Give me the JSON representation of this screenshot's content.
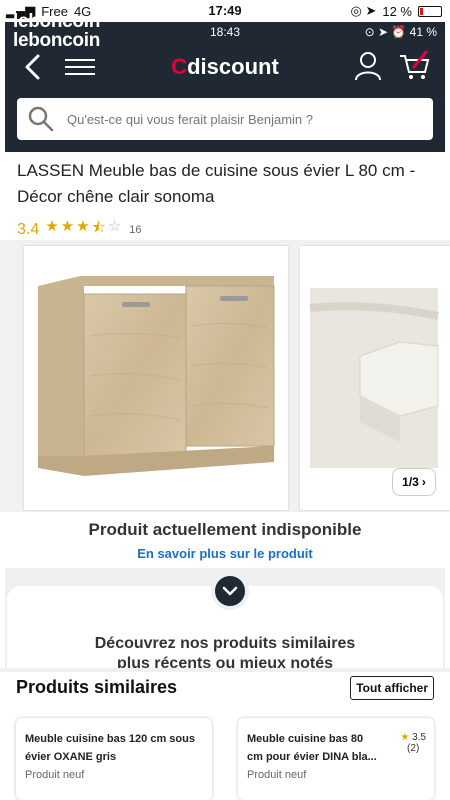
{
  "outer_status": {
    "carrier": "Free",
    "network": "4G",
    "time": "17:49",
    "battery": "12 %",
    "battery_level": 0.12
  },
  "watermark": {
    "line1": "leboncoin",
    "line2": "leboncoin"
  },
  "inner_status": {
    "time": "18:43",
    "battery": "41 %"
  },
  "header": {
    "logo_c": "C",
    "logo_rest": "discount",
    "search_placeholder": "Qu'est-ce qui vous ferait plaisir Benjamin ?"
  },
  "product": {
    "title": "LASSEN Meuble bas de cuisine sous évier L 80 cm - Décor chêne clair sonoma",
    "rating": "3.4",
    "rating_value": 3.4,
    "review_count": "16",
    "pager": "1/3",
    "unavailable": "Produit actuellement indisponible",
    "learn_more": "En savoir plus sur le produit"
  },
  "similar_banner": {
    "line1": "Découvrez nos produits similaires",
    "line2": "plus récents ou mieux notés"
  },
  "similar": {
    "heading": "Produits similaires",
    "show_all": "Tout afficher",
    "items": [
      {
        "name_l1": "Meuble cuisine bas 120 cm sous",
        "name_l2": "évier OXANE gris",
        "condition": "Produit neuf"
      },
      {
        "name_l1": "Meuble cuisine bas 80",
        "name_l2": "cm pour évier DINA bla...",
        "condition": "Produit neuf",
        "rating": "3.5",
        "count": "(2)"
      }
    ]
  },
  "colors": {
    "header_bg": "#202833",
    "brand_red": "#e3003b",
    "link_blue": "#1a6fc9",
    "star": "#e0a700"
  }
}
